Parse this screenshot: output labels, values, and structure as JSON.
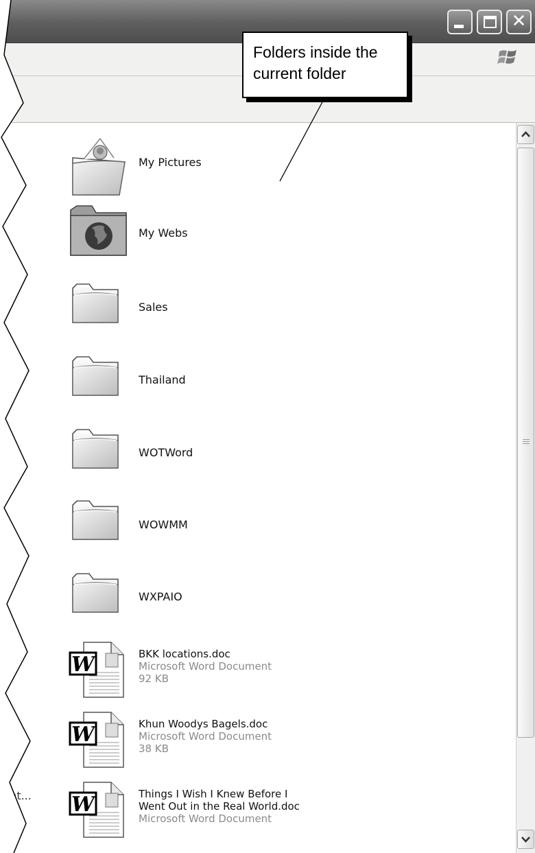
{
  "window": {
    "controls": [
      "minimize",
      "maximize",
      "close"
    ],
    "close_glyph": "✕",
    "logo_icon": "windows-flag-icon"
  },
  "callout": {
    "line1": "Folders inside the",
    "line2": "current folder"
  },
  "items": [
    {
      "name": "My Pictures",
      "icon": "pictures-folder-icon"
    },
    {
      "name": "My Webs",
      "icon": "web-folder-icon"
    },
    {
      "name": "Sales",
      "icon": "folder-icon"
    },
    {
      "name": "Thailand",
      "icon": "folder-icon"
    },
    {
      "name": "WOTWord",
      "icon": "folder-icon"
    },
    {
      "name": "WOWMM",
      "icon": "folder-icon"
    },
    {
      "name": "WXPAIO",
      "icon": "folder-icon"
    }
  ],
  "files": [
    {
      "name": "BKK locations.doc",
      "type": "Microsoft Word Document",
      "size": "92 KB",
      "icon": "word-document-icon"
    },
    {
      "name": "Khun Woodys Bagels.doc",
      "type": "Microsoft Word Document",
      "size": "38 KB",
      "icon": "word-document-icon"
    },
    {
      "name_line1": "Things I Wish I Knew Before I",
      "name_line2": "Went Out in the Real World.doc",
      "type": "Microsoft Word Document",
      "icon": "word-document-icon"
    }
  ],
  "left_pane_partial_text": "sent...",
  "scrollbar": {
    "up_glyph": "⌃",
    "down_glyph": "⌄"
  }
}
